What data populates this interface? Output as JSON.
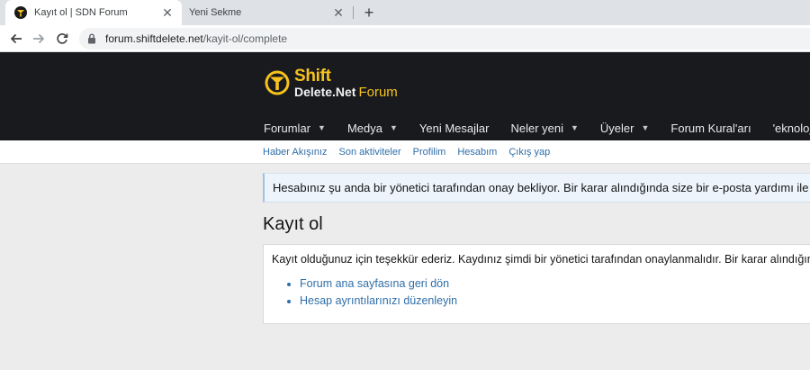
{
  "browser": {
    "tabs": [
      {
        "title": "Kayıt ol | SDN Forum",
        "active": true
      },
      {
        "title": "Yeni Sekme",
        "active": false
      }
    ],
    "close_glyph": "✕",
    "newtab_glyph": "+",
    "url_host": "forum.shiftdelete.net",
    "url_path": "/kayit-ol/complete",
    "icons": {
      "back": "arrow-left-icon",
      "forward": "arrow-right-icon",
      "reload": "reload-icon",
      "lock": "lock-icon"
    }
  },
  "site": {
    "logo": {
      "line1": "Shift",
      "line2_bold": "Delete.Net",
      "line2_suffix": "Forum"
    },
    "nav": [
      {
        "label": "Forumlar",
        "dropdown": true
      },
      {
        "label": "Medya",
        "dropdown": true
      },
      {
        "label": "Yeni Mesajlar",
        "dropdown": false
      },
      {
        "label": "Neler yeni",
        "dropdown": true
      },
      {
        "label": "Üyeler",
        "dropdown": true
      },
      {
        "label": "Forum Kural'arı",
        "dropdown": false
      },
      {
        "label": "'eknoloji Habe",
        "dropdown": false
      }
    ],
    "subnav": [
      "Haber Akışınız",
      "Son aktiviteler",
      "Profilim",
      "Hesabım",
      "Çıkış yap"
    ]
  },
  "main": {
    "notice": "Hesabınız şu anda bir yönetici tarafından onay bekliyor. Bir karar alındığında size bir e-posta yardımı ile bilgilendi",
    "page_title": "Kayıt ol",
    "body_text": "Kayıt olduğunuz için teşekkür ederiz. Kaydınız şimdi bir yönetici tarafından onaylanmalıdır. Bir karar alındığında b",
    "links": [
      "Forum ana sayfasına geri dön",
      "Hesap ayrıntılarınızı düzenleyin"
    ]
  },
  "colors": {
    "header_bg": "#181a1e",
    "brand_yellow": "#f7c21b",
    "link": "#2f6ea8",
    "notice_bg": "#edf4fb"
  }
}
